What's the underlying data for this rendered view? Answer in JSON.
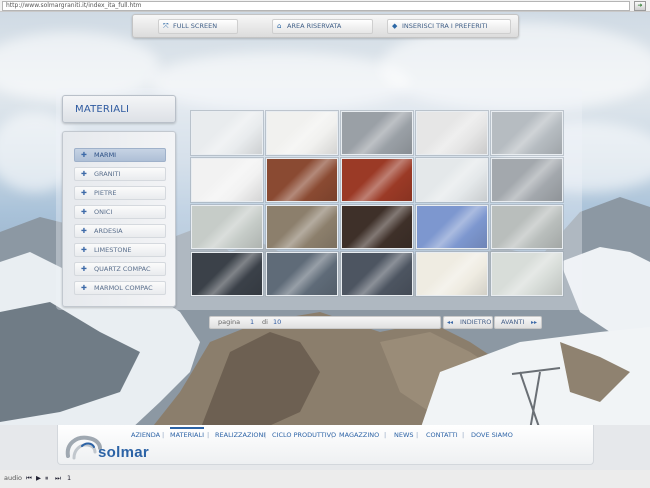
{
  "browser": {
    "url": "http://www.solmargraniti.it/index_ita_full.htm",
    "go_icon": "go-arrow-icon"
  },
  "toolbar": {
    "buttons": [
      {
        "label": "FULL SCREEN",
        "icon": "fullscreen-icon"
      },
      {
        "label": "AREA RISERVATA",
        "icon": "home-lock-icon"
      },
      {
        "label": "INSERISCI TRA I PREFERITI",
        "icon": "favorite-icon"
      }
    ]
  },
  "section": {
    "title": "MATERIALI"
  },
  "menu": {
    "items": [
      {
        "label": "MARMI",
        "active": true
      },
      {
        "label": "GRANITI",
        "active": false
      },
      {
        "label": "PIETRE",
        "active": false
      },
      {
        "label": "ONICI",
        "active": false
      },
      {
        "label": "ARDESIA",
        "active": false
      },
      {
        "label": "LIMESTONE",
        "active": false
      },
      {
        "label": "QUARTZ COMPAC",
        "active": false
      },
      {
        "label": "MARMOL COMPAC",
        "active": false
      }
    ]
  },
  "gallery": {
    "columns": 5,
    "rows": 4,
    "swatch_colors": [
      "#e9ecee",
      "#f1f1ef",
      "#9aa0a6",
      "#e6e6e6",
      "#b6bcc1",
      "#f2f2f2",
      "#8a4a32",
      "#9b3a26",
      "#e4e8ea",
      "#a3a8ad",
      "#c6ccc8",
      "#8c7f6c",
      "#3e3029",
      "#7d97cf",
      "#b9bebc",
      "#3b4149",
      "#5f6b78",
      "#4d5561",
      "#efece2",
      "#d8ddd9"
    ]
  },
  "pager": {
    "label": "pagina",
    "current": "1",
    "of": "di",
    "total": "10",
    "prev_label": "INDIETRO",
    "next_label": "AVANTI"
  },
  "footer": {
    "brand": "solmar",
    "nav": [
      {
        "label": "AZIENDA",
        "active": false
      },
      {
        "label": "MATERIALI",
        "active": true
      },
      {
        "label": "REALIZZAZIONI",
        "active": false
      },
      {
        "label": "CICLO PRODUTTIVO",
        "active": false
      },
      {
        "label": "MAGAZZINO",
        "active": false
      },
      {
        "label": "NEWS",
        "active": false
      },
      {
        "label": "CONTATTI",
        "active": false
      },
      {
        "label": "DOVE SIAMO",
        "active": false
      }
    ]
  },
  "audio": {
    "label": "audio",
    "track": "1"
  },
  "colors": {
    "accent": "#2c63a6",
    "menu_active": "#aebfd6"
  }
}
